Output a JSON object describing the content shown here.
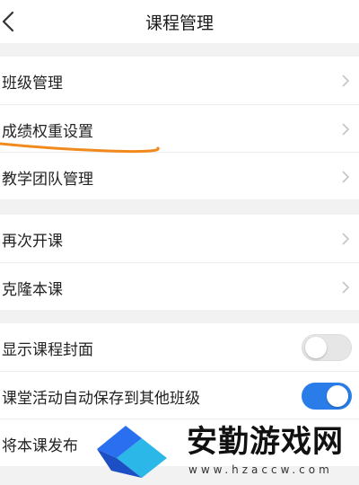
{
  "header": {
    "title": "课程管理"
  },
  "groups": [
    {
      "items": [
        {
          "label": "班级管理"
        },
        {
          "label": "成绩权重设置"
        },
        {
          "label": "教学团队管理"
        }
      ]
    },
    {
      "items": [
        {
          "label": "再次开课"
        },
        {
          "label": "克隆本课"
        }
      ]
    },
    {
      "items": [
        {
          "label": "显示课程封面",
          "enabled": false
        },
        {
          "label": "课堂活动自动保存到其他班级",
          "enabled": true
        },
        {
          "label": "将本课发布"
        }
      ]
    }
  ],
  "watermark": {
    "text": "安勤游戏网",
    "url": "www.hzaccw.com"
  },
  "colors": {
    "toggle_on": "#2a7de8",
    "annotation": "#f08a1c",
    "logo_blue": "#2a6ff0",
    "logo_cyan": "#2bb8e8"
  }
}
